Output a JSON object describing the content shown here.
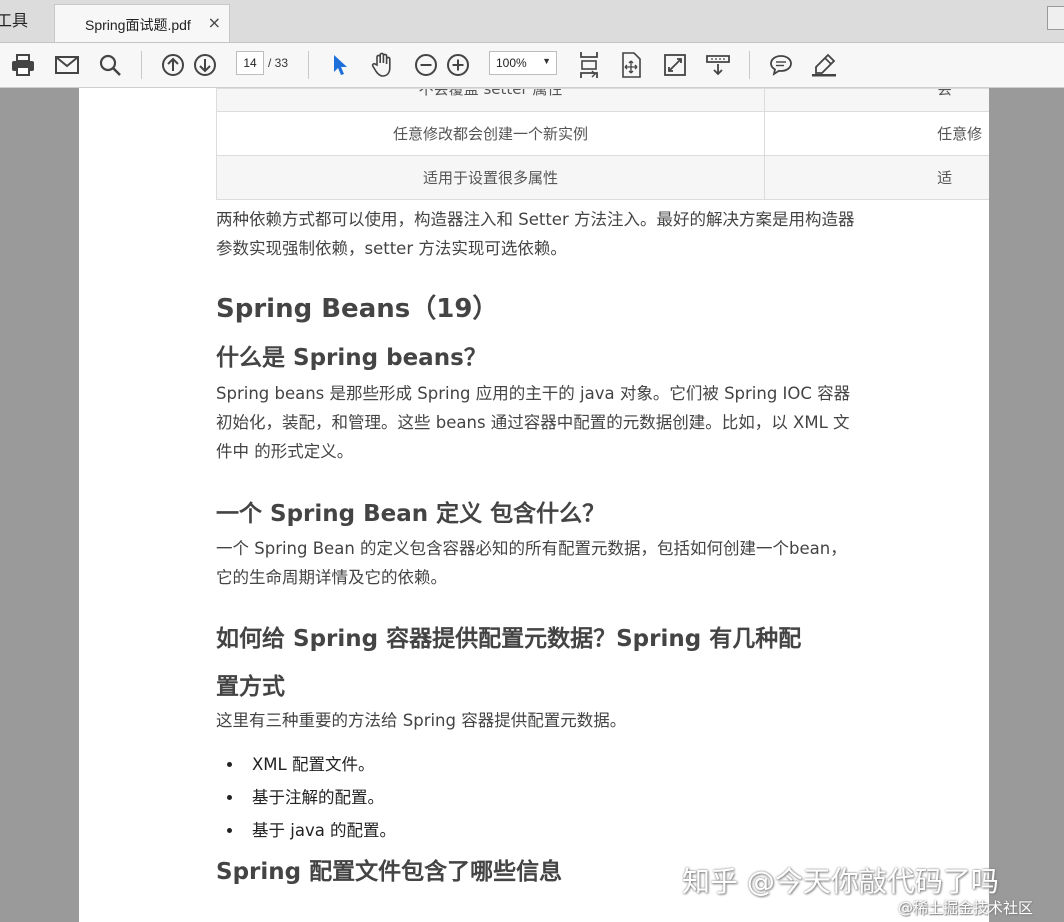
{
  "tabbar": {
    "tools_label": "工具",
    "doc_tab_title": "Spring面试题.pdf",
    "close_glyph": "×"
  },
  "toolbar": {
    "current_page": "14",
    "total_pages": "/ 33",
    "zoom": "100%",
    "icons": [
      "print-icon",
      "mail-icon",
      "search-icon",
      "prev-page-icon",
      "next-page-icon",
      "select-cursor-icon",
      "hand-tool-icon",
      "zoom-out-icon",
      "zoom-in-icon",
      "fit-page-icon",
      "rotate-icon",
      "fullscreen-icon",
      "scroll-mode-icon",
      "comment-icon",
      "highlight-pen-icon"
    ]
  },
  "table": {
    "rows": [
      {
        "c1": "不会覆盖 setter 属性",
        "c2": "会"
      },
      {
        "c1": "任意修改都会创建一个新实例",
        "c2": "任意修"
      },
      {
        "c1": "适用于设置很多属性",
        "c2": "适"
      }
    ]
  },
  "content": {
    "p1": "两种依赖方式都可以使用，构造器注入和 Setter 方法注入。最好的解决方案是用构造器参数实现强制依赖，setter 方法实现可选依赖。",
    "h1": "Spring Beans（19）",
    "h2_1": "什么是 Spring beans？",
    "p2": "Spring beans  是那些形成 Spring 应用的主干的 java 对象。它们被 Spring IOC 容器初始化，装配，和管理。这些 beans 通过容器中配置的元数据创建。比如，以 XML 文件中  的形式定义。",
    "h2_2": "一个  Spring Bean  定义  包含什么？",
    "p3": "一个 Spring Bean  的定义包含容器必知的所有配置元数据，包括如何创建一个bean，它的生命周期详情及它的依赖。",
    "h2_3a": "如何给 Spring  容器提供配置元数据？Spring 有几种配",
    "h2_3b": "置方式",
    "p4": "这里有三种重要的方法给 Spring  容器提供配置元数据。",
    "bullets": [
      "XML 配置文件。",
      "基于注解的配置。",
      "基于 java 的配置。"
    ],
    "h2_4": "Spring 配置文件包含了哪些信息"
  },
  "watermark": {
    "main": "知乎 @今天你敲代码了吗",
    "sub": "@稀土掘金技术社区"
  }
}
